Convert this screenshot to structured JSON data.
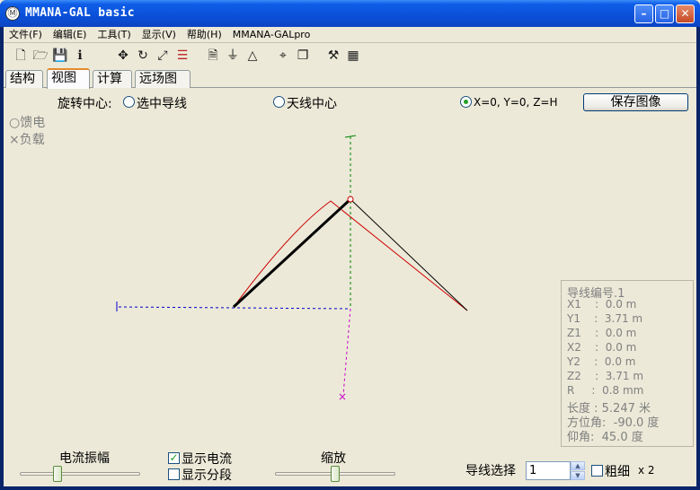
{
  "window": {
    "title": "MMANA-GAL basic"
  },
  "menu": [
    "文件(F)",
    "编辑(E)",
    "工具(T)",
    "显示(V)",
    "帮助(H)",
    "MMANA-GALpro"
  ],
  "tabs": [
    "结构",
    "视图",
    "计算",
    "远场图"
  ],
  "active_tab": "视图",
  "rotation": {
    "label": "旋转中心:",
    "options": [
      "选中导线",
      "天线中心",
      "X=0, Y=0, Z=H"
    ],
    "selected": "X=0, Y=0, Z=H"
  },
  "save_button": "保存图像",
  "legend": {
    "feed": "○馈电",
    "load": "×负载"
  },
  "wire_info": {
    "title": "导线编号.1",
    "rows": [
      "X1    :  0.0 m",
      "Y1    :  3.71 m",
      "Z1    :  0.0 m",
      "X2    :  0.0 m",
      "Y2    :  0.0 m",
      "Z2    :  3.71 m",
      "R     :  0.8 mm"
    ],
    "length": "长度 : 5.247 米",
    "azimuth": "方位角:  -90.0 度",
    "elevation": "仰角:  45.0 度"
  },
  "bottom": {
    "current_amplitude": "电流振幅",
    "show_current": "显示电流",
    "show_current_checked": true,
    "show_segments": "显示分段",
    "show_segments_checked": false,
    "zoom": "缩放",
    "wire_select": "导线选择",
    "wire_select_value": "1",
    "thick": "粗细",
    "thick_factor": "x 2",
    "thick_checked": false,
    "current_amplitude_level": 0.3,
    "zoom_level": 0.5
  },
  "colors": {
    "titlebar": "#0a4fd8",
    "current_curve": "#cc0000",
    "wire": "#000000",
    "axis_z": "#008000",
    "axis_y": "#0000cc",
    "axis_x": "#cc00cc"
  }
}
